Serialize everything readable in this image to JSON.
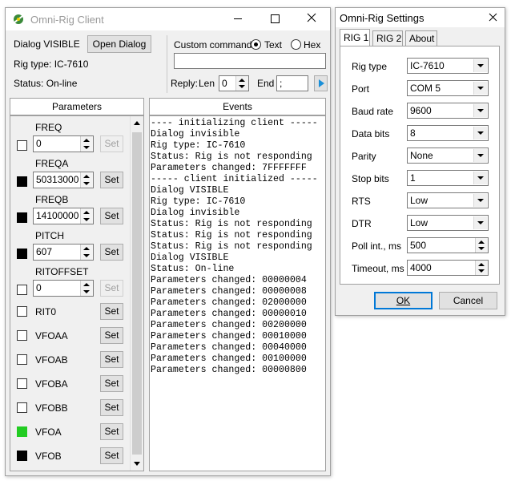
{
  "client": {
    "title": "Omni-Rig Client",
    "dialog_status": "Dialog VISIBLE",
    "open_dialog_label": "Open Dialog",
    "rig_type": "Rig type: IC-7610",
    "status": "Status: On-line",
    "custom_command_label": "Custom command",
    "text_label": "Text",
    "hex_label": "Hex",
    "reply_label": "Reply:",
    "len_label": "Len",
    "len_value": "0",
    "end_label": "End",
    "end_value": ";",
    "parameters_header": "Parameters",
    "events_header": "Events",
    "set_label": "Set",
    "spin_params": [
      {
        "name": "FREQ",
        "value": "0",
        "swatch": "none",
        "set_enabled": false
      },
      {
        "name": "FREQA",
        "value": "50313000",
        "swatch": "#000000",
        "set_enabled": true
      },
      {
        "name": "FREQB",
        "value": "14100000",
        "swatch": "#000000",
        "set_enabled": true
      },
      {
        "name": "PITCH",
        "value": "607",
        "swatch": "#000000",
        "set_enabled": true
      },
      {
        "name": "RITOFFSET",
        "value": "0",
        "swatch": "none",
        "set_enabled": false
      }
    ],
    "flag_params": [
      {
        "name": "RIT0",
        "swatch": "none"
      },
      {
        "name": "VFOAA",
        "swatch": "none"
      },
      {
        "name": "VFOAB",
        "swatch": "none"
      },
      {
        "name": "VFOBA",
        "swatch": "none"
      },
      {
        "name": "VFOBB",
        "swatch": "none"
      },
      {
        "name": "VFOA",
        "swatch": "#22cc22"
      },
      {
        "name": "VFOB",
        "swatch": "#000000"
      }
    ],
    "events": [
      "---- initializing client -----",
      "Dialog invisible",
      "Rig type: IC-7610",
      "Status: Rig is not responding",
      "Parameters changed: 7FFFFFFF",
      "----- client initialized -----",
      "Dialog VISIBLE",
      "Rig type: IC-7610",
      "Dialog invisible",
      "Status: Rig is not responding",
      "Status: Rig is not responding",
      "Status: Rig is not responding",
      "Dialog VISIBLE",
      "Status: On-line",
      "Parameters changed: 00000004",
      "Parameters changed: 00000008",
      "Parameters changed: 02000000",
      "Parameters changed: 00000010",
      "Parameters changed: 00200000",
      "Parameters changed: 00010000",
      "Parameters changed: 00040000",
      "Parameters changed: 00100000",
      "Parameters changed: 00000800"
    ]
  },
  "settings": {
    "title": "Omni-Rig Settings",
    "tabs": [
      "RIG 1",
      "RIG 2",
      "About"
    ],
    "fields": [
      {
        "label": "Rig type",
        "value": "IC-7610",
        "kind": "combo"
      },
      {
        "label": "Port",
        "value": "COM 5",
        "kind": "combo"
      },
      {
        "label": "Baud rate",
        "value": "9600",
        "kind": "combo"
      },
      {
        "label": "Data bits",
        "value": "8",
        "kind": "combo"
      },
      {
        "label": "Parity",
        "value": "None",
        "kind": "combo"
      },
      {
        "label": "Stop bits",
        "value": "1",
        "kind": "combo"
      },
      {
        "label": "RTS",
        "value": "Low",
        "kind": "combo"
      },
      {
        "label": "DTR",
        "value": "Low",
        "kind": "combo"
      },
      {
        "label": "Poll int., ms",
        "value": "500",
        "kind": "spin"
      },
      {
        "label": "Timeout, ms",
        "value": "4000",
        "kind": "spin"
      }
    ],
    "ok_label": "OK",
    "cancel_label": "Cancel"
  }
}
